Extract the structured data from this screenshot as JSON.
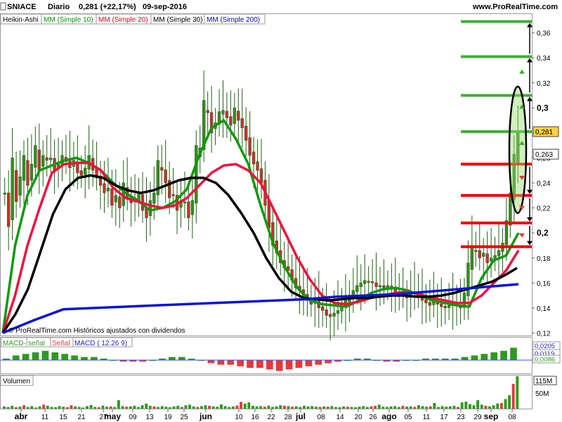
{
  "header": {
    "symbol": "SNIACE",
    "period": "Diario",
    "last": "0,281 (+22,17%)",
    "date": "09-sep-2016",
    "site": "www.ProRealTime.com"
  },
  "indicators": [
    {
      "label": "Heikin-Ashi",
      "color": "#000000"
    },
    {
      "label": "MM (Simple 10)",
      "color": "#009900"
    },
    {
      "label": "MM (Simple 20)",
      "color": "#e00020"
    },
    {
      "label": "MM (Simple 30)",
      "color": "#000000"
    },
    {
      "label": "MM (Simple 200)",
      "color": "#0000cc"
    }
  ],
  "watermark": "© ProRealTime.com Históricos ajustados con dividendos",
  "colors": {
    "up": "#3a8a22",
    "down": "#c83030",
    "ma10": "#0a9a0a",
    "ma20": "#ee1040",
    "ma30": "#000000",
    "ma200": "#0a14d8",
    "target_green": "#3cb030",
    "target_red": "#ee0000"
  },
  "chart_data": [
    {
      "type": "line",
      "title": "SNIACE Diario",
      "ylim": [
        0.118,
        0.375
      ],
      "y_ticks": [
        "0,36",
        "0,34",
        "0,32",
        "0,3",
        "0,28",
        "0,26",
        "0,24",
        "0,22",
        "0,2",
        "0,18",
        "0,16",
        "0,14",
        "0,12"
      ],
      "y_tick_values": [
        0.36,
        0.34,
        0.32,
        0.3,
        0.28,
        0.26,
        0.24,
        0.22,
        0.2,
        0.18,
        0.16,
        0.14,
        0.12
      ],
      "bold_ticks": [
        "0,3",
        "0,2"
      ],
      "price_tags": [
        {
          "label": "0,281",
          "value": 0.281
        },
        {
          "label": "0,263",
          "value": 0.263
        }
      ],
      "x_labels": [
        "abr",
        "11",
        "15",
        "21",
        "27",
        "may",
        "09",
        "13",
        "19",
        "25",
        "jun",
        "10",
        "16",
        "22",
        "28",
        "jul",
        "08",
        "14",
        "20",
        "26",
        "ago",
        "05",
        "11",
        "17",
        "23",
        "29",
        "sep",
        "08"
      ],
      "bold_x_labels": [
        "abr",
        "may",
        "jun",
        "jul",
        "ago",
        "sep"
      ],
      "candle_closes": [
        0.232,
        0.205,
        0.26,
        0.225,
        0.245,
        0.262,
        0.238,
        0.255,
        0.27,
        0.25,
        0.262,
        0.258,
        0.26,
        0.25,
        0.255,
        0.262,
        0.257,
        0.252,
        0.258,
        0.248,
        0.246,
        0.252,
        0.262,
        0.25,
        0.244,
        0.238,
        0.232,
        0.236,
        0.222,
        0.23,
        0.22,
        0.24,
        0.228,
        0.224,
        0.226,
        0.232,
        0.218,
        0.212,
        0.226,
        0.232,
        0.258,
        0.25,
        0.24,
        0.228,
        0.23,
        0.218,
        0.226,
        0.225,
        0.212,
        0.226,
        0.27,
        0.268,
        0.306,
        0.296,
        0.28,
        0.288,
        0.297,
        0.298,
        0.292,
        0.286,
        0.3,
        0.29,
        0.284,
        0.274,
        0.262,
        0.255,
        0.25,
        0.24,
        0.222,
        0.204,
        0.19,
        0.184,
        0.176,
        0.172,
        0.17,
        0.162,
        0.156,
        0.154,
        0.15,
        0.146,
        0.143,
        0.146,
        0.14,
        0.138,
        0.134,
        0.133,
        0.136,
        0.138,
        0.141,
        0.146,
        0.15,
        0.154,
        0.158,
        0.16,
        0.162,
        0.161,
        0.16,
        0.157,
        0.158,
        0.156,
        0.158,
        0.156,
        0.152,
        0.151,
        0.15,
        0.148,
        0.152,
        0.153,
        0.15,
        0.146,
        0.144,
        0.142,
        0.145,
        0.143,
        0.141,
        0.14,
        0.142,
        0.144,
        0.142,
        0.14,
        0.152,
        0.176,
        0.19,
        0.186,
        0.18,
        0.184,
        0.176,
        0.18,
        0.182,
        0.186,
        0.192,
        0.21,
        0.232,
        0.263,
        0.281
      ],
      "series": [
        {
          "name": "MM (Simple 10)",
          "values": [
            0.12,
            0.19,
            0.23,
            0.25,
            0.254,
            0.258,
            0.26,
            0.256,
            0.25,
            0.24,
            0.232,
            0.226,
            0.218,
            0.22,
            0.225,
            0.235,
            0.262,
            0.284,
            0.29,
            0.275,
            0.255,
            0.222,
            0.192,
            0.172,
            0.156,
            0.146,
            0.143,
            0.142,
            0.141,
            0.146,
            0.152,
            0.155,
            0.156,
            0.154,
            0.15,
            0.146,
            0.144,
            0.142,
            0.141,
            0.164,
            0.178,
            0.182,
            0.2
          ]
        },
        {
          "name": "MM (Simple 20)",
          "values": [
            0.12,
            0.15,
            0.19,
            0.22,
            0.248,
            0.255,
            0.256,
            0.256,
            0.25,
            0.236,
            0.228,
            0.225,
            0.222,
            0.22,
            0.222,
            0.228,
            0.238,
            0.248,
            0.254,
            0.255,
            0.25,
            0.24,
            0.22,
            0.2,
            0.18,
            0.163,
            0.15,
            0.144,
            0.143,
            0.145,
            0.148,
            0.15,
            0.152,
            0.153,
            0.151,
            0.148,
            0.146,
            0.144,
            0.144,
            0.15,
            0.16,
            0.17,
            0.186
          ]
        },
        {
          "name": "MM (Simple 30)",
          "values": [
            0.12,
            0.135,
            0.155,
            0.185,
            0.215,
            0.235,
            0.244,
            0.246,
            0.244,
            0.238,
            0.234,
            0.232,
            0.234,
            0.238,
            0.242,
            0.244,
            0.244,
            0.24,
            0.23,
            0.216,
            0.2,
            0.18,
            0.164,
            0.153,
            0.148,
            0.147,
            0.146,
            0.147,
            0.148,
            0.148,
            0.149,
            0.15,
            0.15,
            0.149,
            0.149,
            0.15,
            0.152,
            0.155,
            0.158,
            0.161,
            0.166,
            0.172
          ]
        },
        {
          "name": "MM (Simple 200)",
          "values": [
            0.12,
            0.13,
            0.139,
            0.14,
            0.141,
            0.142,
            0.143,
            0.144,
            0.145,
            0.146,
            0.147,
            0.149,
            0.15,
            0.151,
            0.153,
            0.155,
            0.157,
            0.159
          ]
        }
      ],
      "target_levels": [
        {
          "value": 0.369,
          "color": "green"
        },
        {
          "value": 0.341,
          "color": "green"
        },
        {
          "value": 0.31,
          "color": "green"
        },
        {
          "value": 0.281,
          "color": "green"
        },
        {
          "value": 0.255,
          "color": "red"
        },
        {
          "value": 0.23,
          "color": "red"
        },
        {
          "value": 0.208,
          "color": "red"
        },
        {
          "value": 0.189,
          "color": "red"
        }
      ]
    },
    {
      "type": "bar",
      "title": "MACD",
      "legend": [
        "MACD-",
        "señal",
        "Señal",
        "MACD ( 12.26 9)"
      ],
      "labels": [
        "0,0205",
        "0,0119",
        "0,0086"
      ],
      "values": [
        0.001,
        0.003,
        0.004,
        0.005,
        0.006,
        0.005,
        0.004,
        0.003,
        0.002,
        0.002,
        0.001,
        0.0,
        -0.001,
        -0.001,
        -0.001,
        0.0,
        0.001,
        0.002,
        0.002,
        0.001,
        0.0,
        -0.002,
        -0.003,
        -0.003,
        -0.004,
        -0.005,
        -0.005,
        -0.006,
        -0.007,
        -0.006,
        -0.005,
        -0.004,
        -0.003,
        -0.002,
        -0.001,
        0.0,
        0.001,
        0.001,
        0.0,
        -0.001,
        -0.001,
        0.0,
        0.0,
        0.001,
        0.001,
        0.001,
        0.001,
        0.002,
        0.003,
        0.004,
        0.005,
        0.006,
        0.008
      ]
    },
    {
      "type": "bar",
      "title": "Volumen",
      "labels": [
        "115M",
        "50M"
      ],
      "values": [
        8,
        6,
        10,
        5,
        7,
        12,
        6,
        9,
        4,
        8,
        14,
        10,
        6,
        5,
        9,
        7,
        5,
        12,
        8,
        6,
        4,
        9,
        13,
        6,
        5,
        11,
        7,
        8,
        6,
        30,
        9,
        7,
        8,
        10,
        6,
        12,
        18,
        10,
        8,
        6,
        9,
        7,
        5,
        8,
        10,
        6,
        12,
        14,
        8,
        6,
        9,
        12,
        10,
        8,
        7,
        15,
        9,
        6,
        8,
        11,
        24,
        18,
        22,
        10,
        8,
        9,
        7,
        11,
        6,
        8,
        12,
        10,
        9,
        7,
        8,
        6,
        10,
        8,
        9,
        7,
        6,
        8,
        7,
        9,
        6,
        5,
        8,
        7,
        6,
        5,
        7,
        9,
        6,
        8,
        10,
        14,
        7,
        6,
        8,
        9,
        6,
        10,
        7,
        8,
        6,
        12,
        9,
        7,
        8,
        20,
        6,
        9,
        7,
        8,
        10,
        6,
        22,
        25,
        16,
        12,
        30,
        14,
        10,
        8,
        12,
        18,
        20,
        34,
        48,
        88,
        115
      ]
    }
  ]
}
